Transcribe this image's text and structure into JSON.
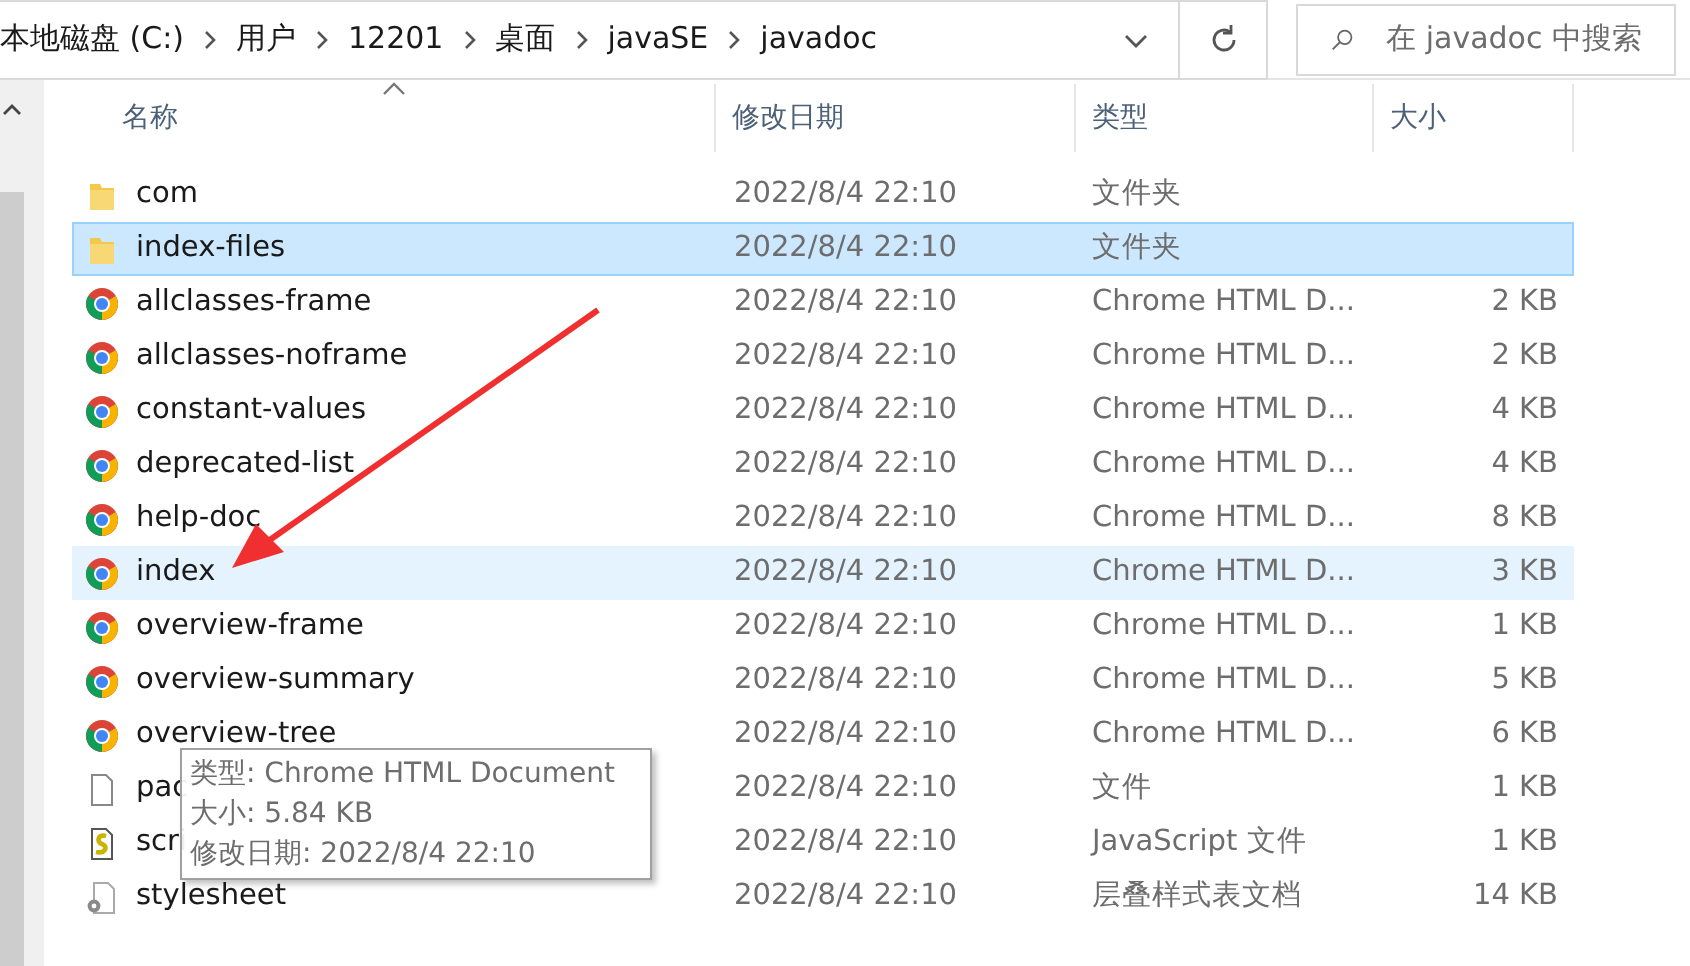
{
  "address_bar": {
    "crumbs": [
      "本地磁盘 (C:)",
      "用户",
      "12201",
      "桌面",
      "javaSE",
      "javadoc"
    ],
    "search_placeholder": "在 javadoc 中搜索"
  },
  "columns": [
    {
      "label": "名称",
      "sorted": true
    },
    {
      "label": "修改日期",
      "sorted": false
    },
    {
      "label": "类型",
      "sorted": false
    },
    {
      "label": "大小",
      "sorted": false
    }
  ],
  "files": [
    {
      "kind": "folder",
      "name": "com",
      "modified": "2022/8/4 22:10",
      "type": "文件夹",
      "selected": false,
      "hovered": false
    },
    {
      "kind": "folder",
      "name": "index-files",
      "modified": "2022/8/4 22:10",
      "type": "文件夹",
      "selected": true,
      "hovered": false
    },
    {
      "kind": "chrome",
      "name": "allclasses-frame",
      "modified": "2022/8/4 22:10",
      "type": "Chrome HTML D...",
      "size": "2 KB",
      "selected": false,
      "hovered": false
    },
    {
      "kind": "chrome",
      "name": "allclasses-noframe",
      "modified": "2022/8/4 22:10",
      "type": "Chrome HTML D...",
      "size": "2 KB",
      "selected": false,
      "hovered": false
    },
    {
      "kind": "chrome",
      "name": "constant-values",
      "modified": "2022/8/4 22:10",
      "type": "Chrome HTML D...",
      "size": "4 KB",
      "selected": false,
      "hovered": false
    },
    {
      "kind": "chrome",
      "name": "deprecated-list",
      "modified": "2022/8/4 22:10",
      "type": "Chrome HTML D...",
      "size": "4 KB",
      "selected": false,
      "hovered": false
    },
    {
      "kind": "chrome",
      "name": "help-doc",
      "modified": "2022/8/4 22:10",
      "type": "Chrome HTML D...",
      "size": "8 KB",
      "selected": false,
      "hovered": false
    },
    {
      "kind": "chrome",
      "name": "index",
      "modified": "2022/8/4 22:10",
      "type": "Chrome HTML D...",
      "size": "3 KB",
      "selected": false,
      "hovered": true
    },
    {
      "kind": "chrome",
      "name": "overview-frame",
      "modified": "2022/8/4 22:10",
      "type": "Chrome HTML D...",
      "size": "1 KB",
      "selected": false,
      "hovered": false
    },
    {
      "kind": "chrome",
      "name": "overview-summary",
      "modified": "2022/8/4 22:10",
      "type": "Chrome HTML D...",
      "size": "5 KB",
      "selected": false,
      "hovered": false
    },
    {
      "kind": "chrome",
      "name": "overview-tree",
      "modified": "2022/8/4 22:10",
      "type": "Chrome HTML D...",
      "size": "6 KB",
      "selected": false,
      "hovered": false
    },
    {
      "kind": "file",
      "name": "pac",
      "modified": "2022/8/4 22:10",
      "type": "文件",
      "size": "1 KB",
      "selected": false,
      "hovered": false
    },
    {
      "kind": "script",
      "name": "scri",
      "modified": "2022/8/4 22:10",
      "type": "JavaScript 文件",
      "size": "1 KB",
      "selected": false,
      "hovered": false
    },
    {
      "kind": "css",
      "name": "stylesheet",
      "modified": "2022/8/4 22:10",
      "type": "层叠样式表文档",
      "size": "14 KB",
      "selected": false,
      "hovered": false
    }
  ],
  "tooltip": {
    "lines": [
      "类型: Chrome HTML Document",
      "大小: 5.84 KB",
      "修改日期: 2022/8/4 22:10"
    ]
  },
  "annotation": {
    "kind": "arrow"
  }
}
